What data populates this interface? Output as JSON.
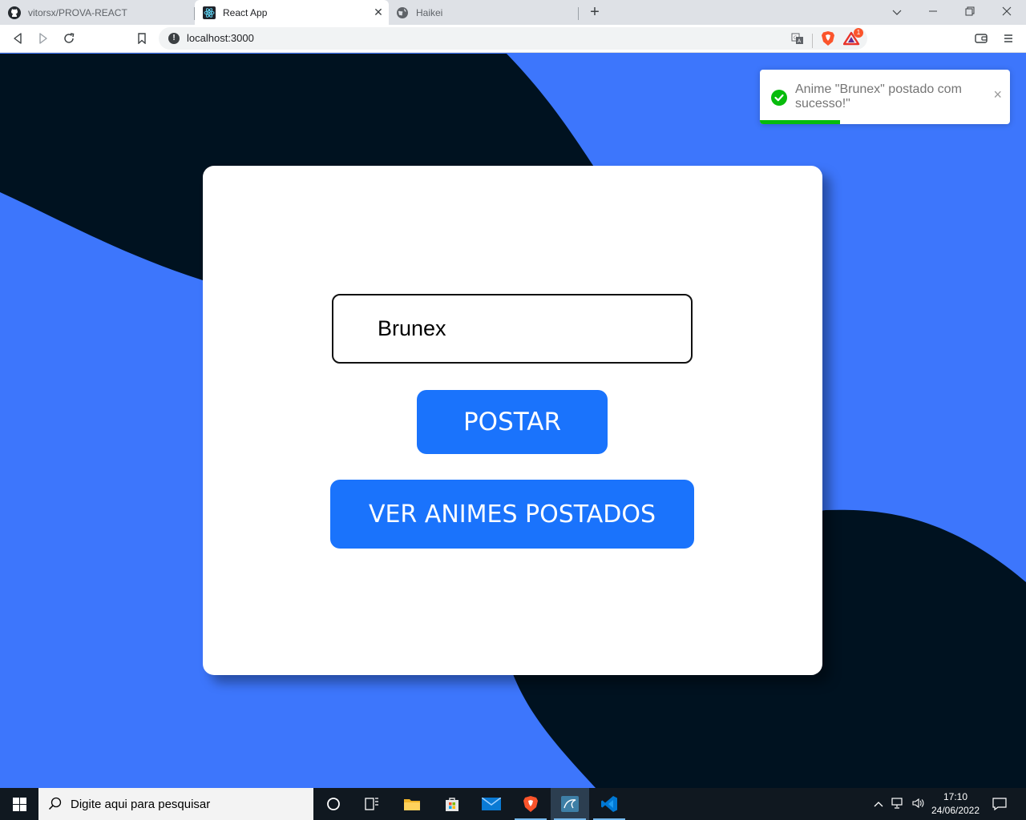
{
  "browser": {
    "tabs": [
      {
        "title": "vitorsx/PROVA-REACT",
        "icon": "github-icon",
        "active": false
      },
      {
        "title": "React App",
        "icon": "react-icon",
        "active": true
      },
      {
        "title": "Haikei",
        "icon": "globe-icon",
        "active": false
      }
    ],
    "new_tab_label": "+",
    "url": "localhost:3000",
    "brave_rewards_badge": "1"
  },
  "page": {
    "input_value": "Brunex",
    "postar_label": "POSTAR",
    "ver_label": "VER ANIMES POSTADOS"
  },
  "toast": {
    "message": "Anime \"Brunex\" postado com sucesso!\"",
    "close_label": "×",
    "progress": 0.32,
    "color": "#07bc0c"
  },
  "taskbar": {
    "search_placeholder": "Digite aqui para pesquisar",
    "time": "17:10",
    "date": "24/06/2022"
  },
  "colors": {
    "background_blue": "#3d76fc",
    "wave_dark": "#001220",
    "button_blue": "#1a73fc"
  }
}
